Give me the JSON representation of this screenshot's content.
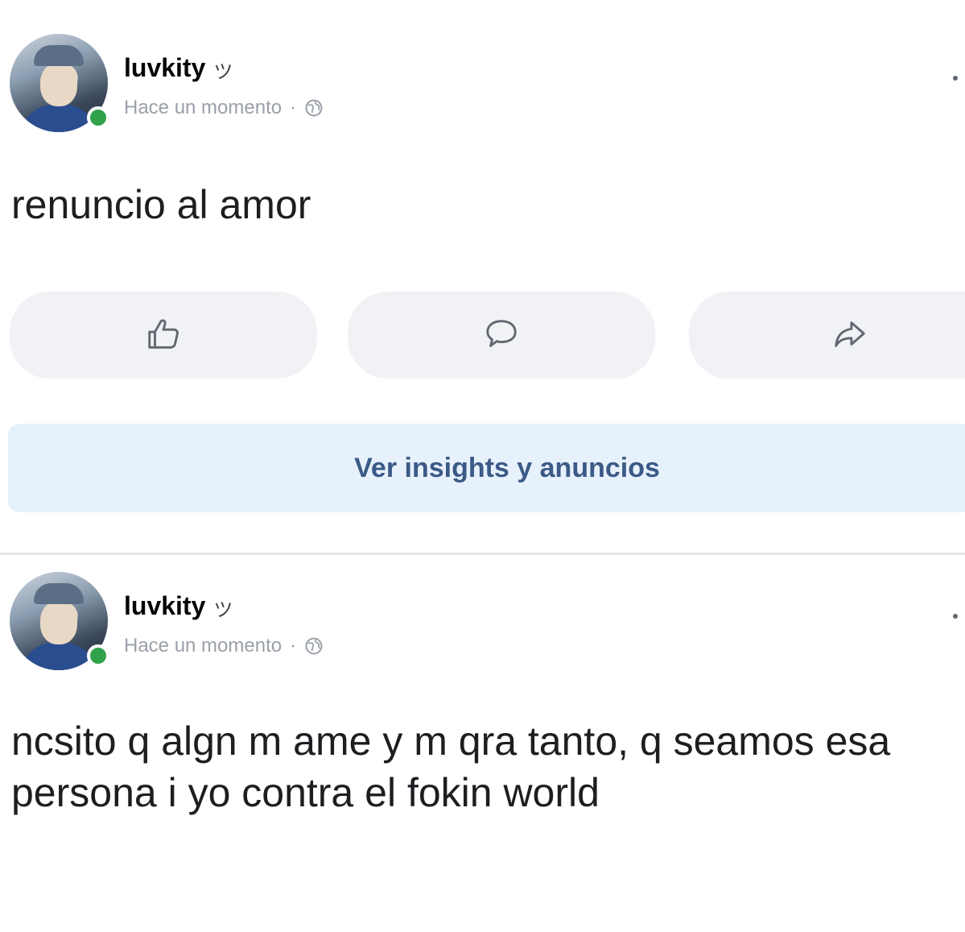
{
  "posts": [
    {
      "author": "luvkity",
      "author_emoji": "ツ",
      "time": "Hace un momento",
      "separator": "·",
      "text": "renuncio al amor",
      "insights_label": "Ver insights y anuncios"
    },
    {
      "author": "luvkity",
      "author_emoji": "ツ",
      "time": "Hace un momento",
      "separator": "·",
      "text": "ncsito q algn m ame y m qra tanto, q seamos esa persona i yo contra el fokin world"
    }
  ],
  "icons": {
    "like": "thumbs-up-icon",
    "comment": "comment-bubble-icon",
    "share": "share-arrow-icon",
    "privacy": "globe-icon",
    "online": "online-status-dot"
  },
  "colors": {
    "online": "#31a24c",
    "insights_bg": "#e7f1fc",
    "insights_text": "#3b5a86",
    "action_bg": "#f0f2f5",
    "meta_text": "#9aa0a8"
  }
}
